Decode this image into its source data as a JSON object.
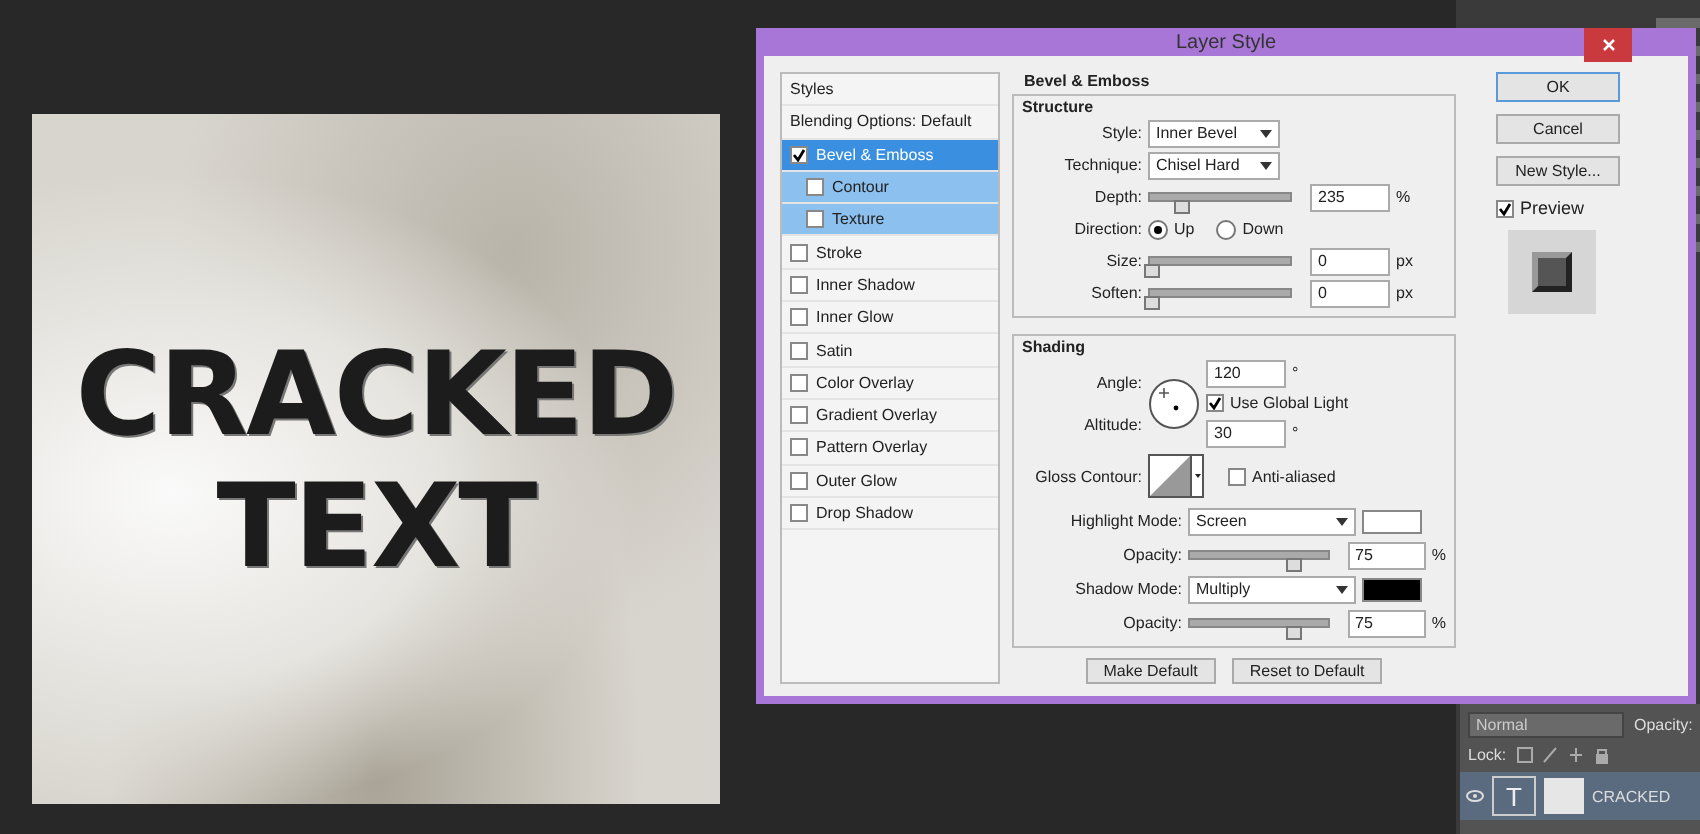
{
  "canvas": {
    "lines": [
      "CRACKED",
      "TEXT"
    ]
  },
  "dialog": {
    "title": "Layer Style",
    "styles": {
      "header": "Styles",
      "items": [
        {
          "label": "Blending Options: Default",
          "kind": "plain",
          "selected": false
        },
        {
          "label": "Bevel & Emboss",
          "kind": "check",
          "checked": true,
          "selected": true,
          "children": [
            {
              "label": "Contour",
              "kind": "check",
              "checked": false,
              "selected": false
            },
            {
              "label": "Texture",
              "kind": "check",
              "checked": false,
              "selected": false
            }
          ]
        },
        {
          "label": "Stroke",
          "kind": "check",
          "checked": false,
          "selected": false
        },
        {
          "label": "Inner Shadow",
          "kind": "check",
          "checked": false,
          "selected": false
        },
        {
          "label": "Inner Glow",
          "kind": "check",
          "checked": false,
          "selected": false
        },
        {
          "label": "Satin",
          "kind": "check",
          "checked": false,
          "selected": false
        },
        {
          "label": "Color Overlay",
          "kind": "check",
          "checked": false,
          "selected": false
        },
        {
          "label": "Gradient Overlay",
          "kind": "check",
          "checked": false,
          "selected": false
        },
        {
          "label": "Pattern Overlay",
          "kind": "check",
          "checked": false,
          "selected": false
        },
        {
          "label": "Outer Glow",
          "kind": "check",
          "checked": false,
          "selected": false
        },
        {
          "label": "Drop Shadow",
          "kind": "check",
          "checked": false,
          "selected": false
        }
      ]
    },
    "section_title": "Bevel & Emboss",
    "structure": {
      "title": "Structure",
      "rows": [
        {
          "kind": "dropdown",
          "label": "Style:",
          "value": "Inner Bevel"
        },
        {
          "kind": "dropdown",
          "label": "Technique:",
          "value": "Chisel Hard"
        },
        {
          "kind": "slider",
          "label": "Depth:",
          "level": 0.22,
          "value": "235",
          "unit": "%"
        },
        {
          "kind": "radios",
          "label": "Direction:",
          "options": [
            {
              "label": "Up",
              "selected": true
            },
            {
              "label": "Down",
              "selected": false
            }
          ]
        },
        {
          "kind": "slider",
          "label": "Size:",
          "level": 0.0,
          "value": "0",
          "unit": "px"
        },
        {
          "kind": "slider",
          "label": "Soften:",
          "level": 0.0,
          "value": "0",
          "unit": "px"
        }
      ]
    },
    "shading": {
      "title": "Shading",
      "angle": {
        "label": "Angle:",
        "value": "120",
        "unit": "°"
      },
      "global_light": {
        "label": "Use Global Light",
        "checked": true
      },
      "altitude": {
        "label": "Altitude:",
        "value": "30",
        "unit": "°"
      },
      "gloss_contour": {
        "label": "Gloss Contour:"
      },
      "anti_aliased": {
        "label": "Anti-aliased",
        "checked": false
      },
      "modes": [
        {
          "label": "Highlight Mode:",
          "value": "Screen",
          "color": "#ffffff",
          "opacity_label": "Opacity:",
          "level": 0.75,
          "opacity": "75",
          "unit": "%"
        },
        {
          "label": "Shadow Mode:",
          "value": "Multiply",
          "color": "#000000",
          "opacity_label": "Opacity:",
          "level": 0.75,
          "opacity": "75",
          "unit": "%"
        }
      ]
    },
    "footer_buttons": [
      "Make Default",
      "Reset to Default"
    ],
    "buttons": [
      "OK",
      "Cancel",
      "New Style..."
    ],
    "preview": {
      "label": "Preview",
      "checked": true
    }
  },
  "layers": {
    "blend_mode": "Normal",
    "opacity_label": "Opacity:",
    "lock_label": "Lock:",
    "layer_thumb_glyph": "T",
    "layer_name": "CRACKED"
  }
}
